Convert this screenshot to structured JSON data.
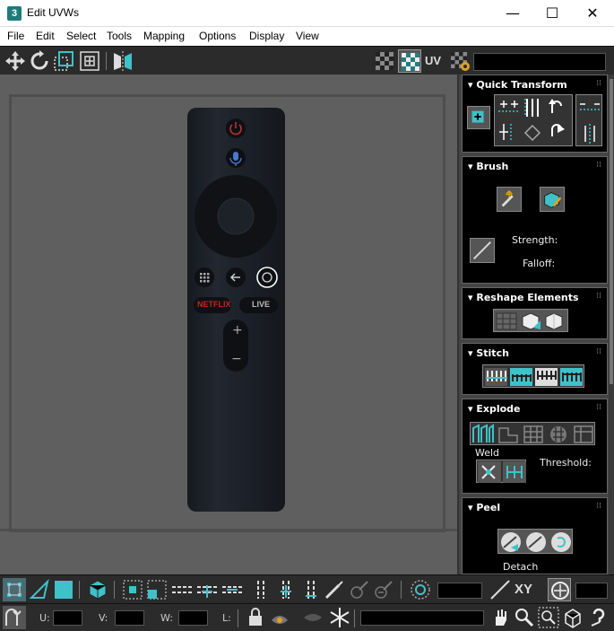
{
  "window": {
    "app_icon": "3",
    "title": "Edit UVWs",
    "controls": {
      "minimize": "—",
      "maximize": "☐",
      "close": "✕"
    }
  },
  "menu": [
    "File",
    "Edit",
    "Select",
    "Tools",
    "Mapping",
    "Options",
    "Display",
    "View"
  ],
  "top_toolbar": {
    "uv_label": "UV",
    "map_select_value": ""
  },
  "remote": {
    "buttons": {
      "netflix": "NETFLIX",
      "live": "LIVE",
      "vol_plus": "+",
      "vol_minus": "−"
    }
  },
  "panel": {
    "quick_transform": {
      "title": "Quick Transform"
    },
    "brush": {
      "title": "Brush",
      "strength_label": "Strength:",
      "falloff_label": "Falloff:"
    },
    "reshape": {
      "title": "Reshape Elements"
    },
    "stitch": {
      "title": "Stitch"
    },
    "explode": {
      "title": "Explode",
      "weld_label": "Weld",
      "threshold_label": "Threshold:"
    },
    "peel": {
      "title": "Peel",
      "detach_label": "Detach"
    },
    "grip": "⁞⁞"
  },
  "bottom_toolbar": {
    "xy_label": "XY",
    "u_label": "U:",
    "v_label": "V:",
    "w_label": "W:",
    "l_label": "L:"
  },
  "colors": {
    "accent": "#3fc1c9",
    "panel_bg": "#000000",
    "toolbar_bg": "#2b2b2b",
    "viewport_bg": "#5f5f5f"
  }
}
